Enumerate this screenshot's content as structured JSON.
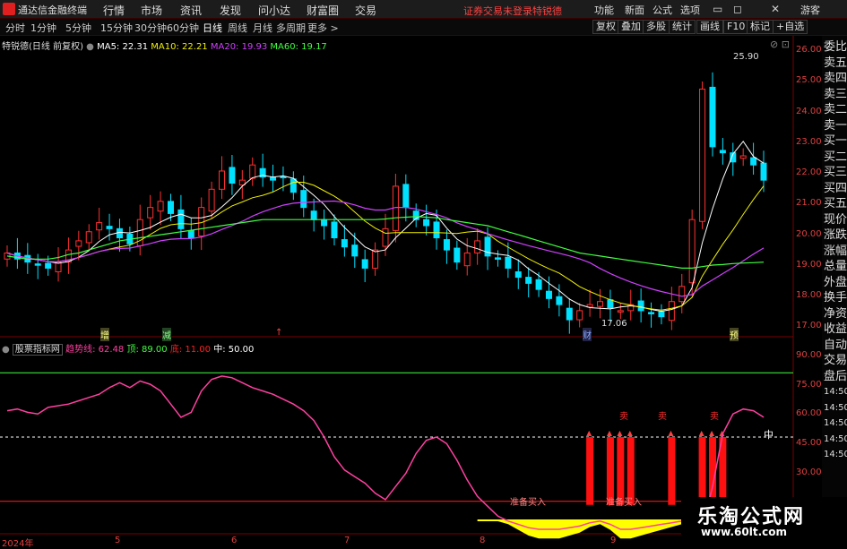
{
  "app": {
    "title": "通达信金融终端"
  },
  "menu": [
    "行情",
    "市场",
    "资讯",
    "发现",
    "问小达",
    "财富圈",
    "交易"
  ],
  "notice": {
    "login": "证券交易未登录",
    "stock": "特锐德"
  },
  "top_right": [
    "功能",
    "新面",
    "公式",
    "选项",
    "游客"
  ],
  "periods": [
    "分时",
    "1分钟",
    "5分钟",
    "15分钟",
    "30分钟",
    "60分钟",
    "日线",
    "周线",
    "月线",
    "多周期",
    "更多 >"
  ],
  "active_period": "日线",
  "tools": [
    "复权",
    "叠加",
    "多股",
    "统计",
    "画线",
    "F10",
    "标记",
    "+自选"
  ],
  "ma_legend": {
    "name": "特锐德(日线 前复权)",
    "items": [
      {
        "label": "MA5: 22.31",
        "color": "#ffffff"
      },
      {
        "label": "MA10: 22.21",
        "color": "#f0f000"
      },
      {
        "label": "MA20: 19.93",
        "color": "#d040ff"
      },
      {
        "label": "MA60: 19.17",
        "color": "#40ff40"
      }
    ]
  },
  "ind_legend": {
    "name": "股票指标网",
    "items": [
      {
        "label": "趋势线: 62.48",
        "color": "#ff40a0"
      },
      {
        "label": "顶: 89.00",
        "color": "#40ff40"
      },
      {
        "label": "底: 11.00",
        "color": "#ff2020"
      },
      {
        "label": "中: 50.00",
        "color": "#ffffff"
      }
    ]
  },
  "price_axis": [
    "26.00",
    "25.00",
    "24.00",
    "23.00",
    "22.00",
    "21.00",
    "20.00",
    "19.00",
    "18.00",
    "17.00"
  ],
  "ind_axis": [
    "90.00",
    "75.00",
    "60.00",
    "45.00",
    "30.00"
  ],
  "annotations": {
    "high": "25.90",
    "low": "17.06",
    "mid_label": "中",
    "buy1": "准备买入",
    "buy2": "准备买入",
    "sell": "卖"
  },
  "date_axis": [
    "2024年",
    "5",
    "6",
    "7",
    "8",
    "9"
  ],
  "event_marks": [
    "增",
    "减",
    "↑",
    "财",
    "预"
  ],
  "sidebar": [
    "委比",
    "卖五",
    "卖四",
    "卖三",
    "卖二",
    "卖一",
    "买一",
    "买二",
    "买三",
    "买四",
    "买五",
    "现价",
    "涨跌",
    "涨幅",
    "总量",
    "外盘",
    "换手",
    "净资",
    "收益",
    "自动",
    "交易",
    "盘后",
    "14:50",
    "14:50",
    "14:50",
    "14:50",
    "14:50"
  ],
  "watermark": {
    "title": "乐淘公式网",
    "url": "www.60lt.com"
  },
  "colors": {
    "up": "#ff3030",
    "down": "#00e0ff",
    "ma5": "#ffffff",
    "ma10": "#f0f000",
    "ma20": "#d040ff",
    "ma60": "#40ff40",
    "trend": "#ff40a0",
    "buy_area": "#ffff00"
  },
  "chart_data": {
    "type": "line",
    "note_series": [
      {
        "name": "MA5",
        "color": "#ffffff"
      },
      {
        "name": "MA10",
        "color": "#f0f000"
      },
      {
        "name": "MA20",
        "color": "#d040ff"
      },
      {
        "name": "MA60",
        "color": "#40ff40"
      },
      {
        "name": "趋势线",
        "color": "#ff40a0"
      }
    ],
    "price_ylim": [
      16.8,
      26.3
    ],
    "ind_ylim": [
      0,
      100
    ],
    "close": [
      19.5,
      19.3,
      19.2,
      19.1,
      19.0,
      19.2,
      19.6,
      19.9,
      20.2,
      20.5,
      20.3,
      20.0,
      19.8,
      20.6,
      21.0,
      21.2,
      20.8,
      20.3,
      20.0,
      21.0,
      21.6,
      22.2,
      21.8,
      21.9,
      22.4,
      22.0,
      21.9,
      22.0,
      21.5,
      21.0,
      20.6,
      20.4,
      20.0,
      19.7,
      19.4,
      19.0,
      19.6,
      20.3,
      21.7,
      21.0,
      20.6,
      20.4,
      20.0,
      19.6,
      19.2,
      19.5,
      19.9,
      19.4,
      19.3,
      19.0,
      18.7,
      18.5,
      18.3,
      18.0,
      17.8,
      17.3,
      17.6,
      17.8,
      17.9,
      17.7,
      17.6,
      17.8,
      17.6,
      17.5,
      17.4,
      17.9,
      18.4,
      20.6,
      24.9,
      23.0,
      22.8,
      22.5,
      22.7,
      22.4,
      21.9
    ],
    "trend": [
      66,
      67,
      65,
      64,
      68,
      69,
      70,
      72,
      74,
      76,
      80,
      83,
      80,
      84,
      82,
      78,
      70,
      62,
      65,
      78,
      85,
      87,
      86,
      83,
      80,
      78,
      76,
      73,
      70,
      66,
      60,
      50,
      38,
      30,
      26,
      22,
      16,
      12,
      20,
      28,
      40,
      48,
      50,
      46,
      36,
      24,
      14,
      8,
      2,
      -1,
      -3,
      -5,
      -6,
      -6,
      -6,
      -5,
      -4,
      -2,
      -1,
      -3,
      -6,
      -6,
      -5,
      -4,
      -3,
      -2,
      -1,
      -3,
      -5,
      20,
      52,
      64,
      67,
      66,
      62
    ],
    "ma60": [
      19.4,
      19.35,
      19.3,
      19.3,
      19.3,
      19.35,
      19.45,
      19.5,
      19.6,
      19.7,
      19.8,
      19.9,
      19.95,
      20.0,
      20.05,
      20.1,
      20.15,
      20.2,
      20.25,
      20.3,
      20.35,
      20.4,
      20.45,
      20.5,
      20.55,
      20.6,
      20.6,
      20.6,
      20.6,
      20.6,
      20.6,
      20.6,
      20.6,
      20.6,
      20.6,
      20.6,
      20.6,
      20.62,
      20.66,
      20.68,
      20.7,
      20.68,
      20.66,
      20.6,
      20.55,
      20.5,
      20.45,
      20.4,
      20.3,
      20.2,
      20.1,
      20.0,
      19.9,
      19.8,
      19.7,
      19.6,
      19.5,
      19.45,
      19.4,
      19.35,
      19.3,
      19.25,
      19.2,
      19.15,
      19.1,
      19.05,
      19.0,
      19.0,
      19.05,
      19.1,
      19.12,
      19.15,
      19.17,
      19.18,
      19.2
    ]
  }
}
